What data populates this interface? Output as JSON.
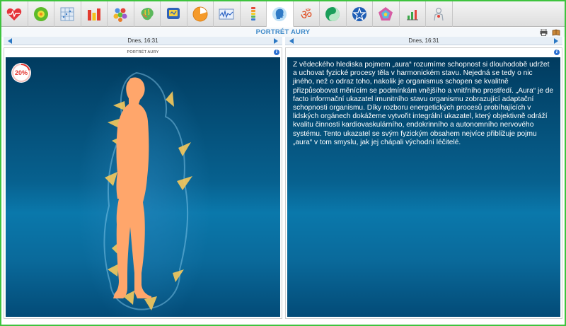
{
  "toolbar": {
    "icons": [
      "heart-icon",
      "ball-icon",
      "grid-icon",
      "bar-chart-icon",
      "molecule-icon",
      "brain-icon",
      "monitor-icon",
      "pie-icon",
      "wave-icon",
      "spine-icon",
      "head-icon",
      "om-icon",
      "yin-yang-icon",
      "star-icon",
      "pentagon-icon",
      "small-bars-icon",
      "person-icon"
    ],
    "active_index": 10
  },
  "header": {
    "title": "PORTRÉT AURY"
  },
  "left_date": "Dnes, 16:31",
  "right_date": "Dnes, 16:31",
  "left_panel": {
    "title": "PORTRÉT AURY",
    "percent": "20%",
    "percent_value": 20,
    "accent": "#e3352f",
    "figure_color": "#ffa66b",
    "aura_color": "#f7c95b"
  },
  "right_panel": {
    "text": "Z vědeckého hlediska pojmem „aura“ rozumíme schopnost si dlouhodobě udržet a uchovat fyzické procesy těla v harmonickém stavu. Nejedná se tedy o nic jiného, než o odraz toho, nakolik je organismus schopen se kvalitně přizpůsobovat měnícím se podmínkám vnějšího a vnitřního prostředí. „Aura“ je de facto informační ukazatel imunitního stavu organismu zobrazující adaptační schopnosti organismu. Díky rozboru energetických procesů probíhajících v lidských orgánech dokážeme vytvořit integrální ukazatel, který objektivně odráží kvalitu činnosti kardiovaskulárního, endokrinního a autonomního nervového systému. Tento ukazatel se svým fyzickým obsahem nejvíce přibližuje pojmu „aura“ v tom smyslu, jak jej chápali východní léčitelé."
  }
}
